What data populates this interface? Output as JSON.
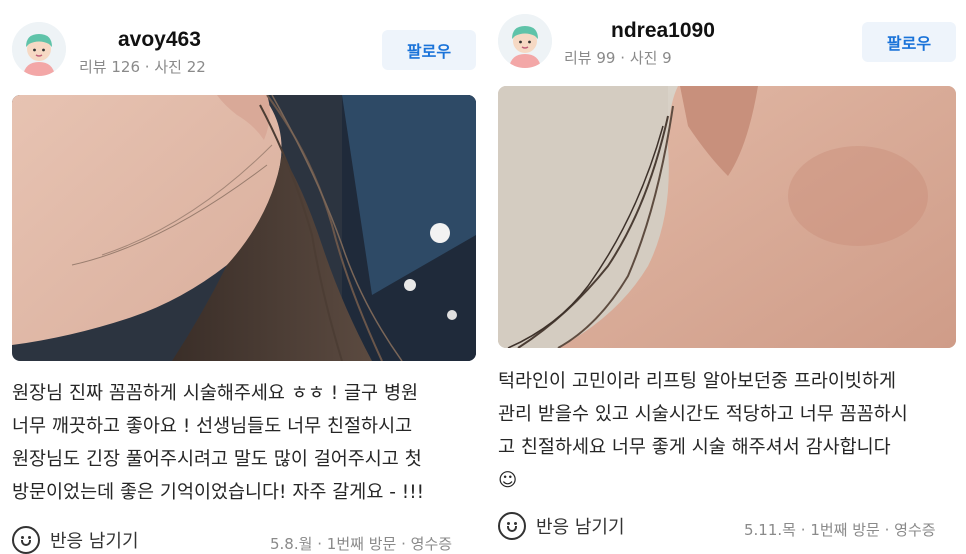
{
  "reviews": [
    {
      "username": "avoy463",
      "review_count": "리뷰 126",
      "photo_count": "사진 22",
      "sep": "·",
      "follow_label": "팔로우",
      "text": "원장님 진짜 꼼꼼하게 시술해주세요 ㅎㅎ ! 글구 병원\n너무 깨끗하고 좋아요 ! 선생님들도 너무 친절하시고\n원장님도 긴장 풀어주시려고 말도 많이 걸어주시고 첫\n방문이었는데 좋은 기억이었습니다! 자주 갈게요 - !!!",
      "react_label": "반응 남기기",
      "visit_date": "5.8.월",
      "visit_count": "1번째 방문",
      "receipt": "영수증"
    },
    {
      "username": "ndrea1090",
      "review_count": "리뷰 99",
      "photo_count": "사진 9",
      "sep": "·",
      "follow_label": "팔로우",
      "text": "턱라인이 고민이라 리프팅 알아보던중 프라이빗하게\n관리 받을수 있고 시술시간도 적당하고 너무 꼼꼼하시\n고 친절하세요 너무 좋게 시술 해주셔서 감사합니다\n☺",
      "react_label": "반응 남기기",
      "visit_date": "5.11.목",
      "visit_count": "1번째 방문",
      "receipt": "영수증"
    }
  ],
  "colors": {
    "follow_text": "#1a73d9",
    "follow_bg": "#eef4fb",
    "meta": "#8a8a8a"
  },
  "icons": {
    "avatar": "cartoon-avatar-icon",
    "react": "smile-icon"
  }
}
